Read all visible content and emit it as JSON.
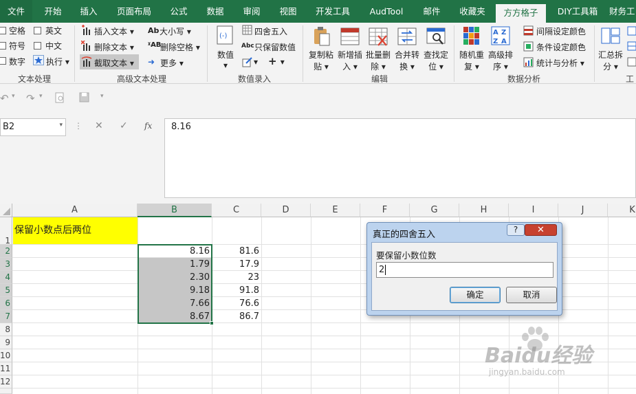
{
  "tabs": {
    "file": "文件",
    "home": "开始",
    "insert": "插入",
    "page_layout": "页面布局",
    "formulas": "公式",
    "data": "数据",
    "review": "审阅",
    "view": "视图",
    "developer": "开发工具",
    "audtool": "AudTool",
    "mail": "邮件",
    "favorites": "收藏夹",
    "fangfang": "方方格子",
    "diy": "DIY工具箱",
    "finance": "财务工"
  },
  "ribbon": {
    "text_processing": {
      "space": "空格",
      "english": "英文",
      "symbol": "符号",
      "chinese": "中文",
      "digit": "数字",
      "execute": "执行",
      "label": "文本处理"
    },
    "advanced_text": {
      "insert_text": "插入文本",
      "case": "大小写",
      "delete_text": "删除文本",
      "delete_space": "删除空格",
      "extract_text": "截取文本",
      "more": "更多",
      "label": "高级文本处理"
    },
    "numeric_entry": {
      "value": "数值",
      "round": "四舍五入",
      "keep_value": "只保留数值",
      "label": "数值录入"
    },
    "edit": {
      "copy_paste": [
        "复制粘",
        "贴"
      ],
      "add_insert": [
        "新增插",
        "入"
      ],
      "batch_delete": [
        "批量删",
        "除"
      ],
      "merge_convert": [
        "合并转",
        "换"
      ],
      "find_locate": [
        "查找定",
        "位"
      ],
      "label": "编辑"
    },
    "analysis": {
      "random_repeat": [
        "随机重",
        "复"
      ],
      "advanced_sort": [
        "高级排",
        "序"
      ],
      "interval_color": "间隔设定颜色",
      "conditional_color": "条件设定颜色",
      "stats": "统计与分析",
      "label": "数据分析"
    },
    "more": {
      "summary_split": [
        "汇总拆",
        "分"
      ],
      "label": "工"
    }
  },
  "formula_bar": {
    "name_box": "B2",
    "cancel": "✕",
    "enter": "✓",
    "fx": "fx",
    "content": "8.16"
  },
  "columns": [
    "A",
    "B",
    "C",
    "D",
    "E",
    "F",
    "G",
    "H",
    "I",
    "J",
    "K"
  ],
  "rows": [
    "1",
    "2",
    "3",
    "4",
    "5",
    "6",
    "7",
    "8",
    "9",
    "10",
    "11",
    "12"
  ],
  "cells": {
    "A1": "保留小数点后两位",
    "B": [
      "8.16",
      "1.79",
      "2.30",
      "9.18",
      "7.66",
      "8.67"
    ],
    "C": [
      "81.6",
      "17.9",
      "23",
      "91.8",
      "76.6",
      "86.7"
    ]
  },
  "dialog": {
    "title": "真正的四舍五入",
    "help": "?",
    "close": "✕",
    "prompt": "要保留小数位数",
    "input_value": "2",
    "ok": "确定",
    "cancel": "取消"
  },
  "watermark": {
    "brand": "Baidu经验",
    "url": "jingyan.baidu.com"
  },
  "colors": {
    "excel_green": "#217346",
    "highlight_yellow": "#ffff00",
    "selection_gray": "#c6c6c6"
  }
}
